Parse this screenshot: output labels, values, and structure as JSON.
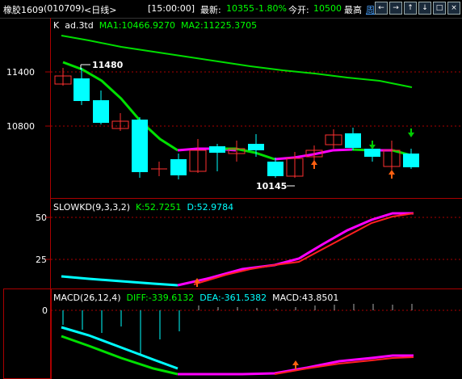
{
  "header": {
    "symbol": "橡胶1609",
    "code": "(010709)",
    "period_tag": "<日线>",
    "time": "[15:00:00]",
    "latest_label": "最新:",
    "latest_value": "10355",
    "change_pct": "-1.80%",
    "open_label": "今开:",
    "open_value": "10500",
    "high_label": "最高",
    "period_link": "周期",
    "buttons": [
      "←",
      "→",
      "↑",
      "↓",
      "□",
      "×"
    ]
  },
  "main_chart": {
    "title_k": "K",
    "title_ad": "ad.3td",
    "ma1_text": "MA1:10466.9270",
    "ma2_text": "MA2:11225.3705",
    "y_ticks": [
      "11400",
      "10800"
    ],
    "high_annot": "11480",
    "low_annot": "10145",
    "colors": {
      "ma1": "#00e000",
      "ma2": "#00dd00",
      "up": "#ff3030",
      "down": "#00ffff",
      "magenta": "#ff00ff"
    }
  },
  "kd_panel": {
    "title": "SLOWKD(9,3,3,2)",
    "k_text": "K:52.7251",
    "d_text": "D:52.9784",
    "y_ticks": [
      "50",
      "25"
    ]
  },
  "macd_panel": {
    "title": "MACD(26,12,4)",
    "diff_text": "DIFF:-339.6132",
    "dea_text": "DEA:-361.5382",
    "macd_text": "MACD:43.8501",
    "y_ticks": [
      "0"
    ]
  }
}
